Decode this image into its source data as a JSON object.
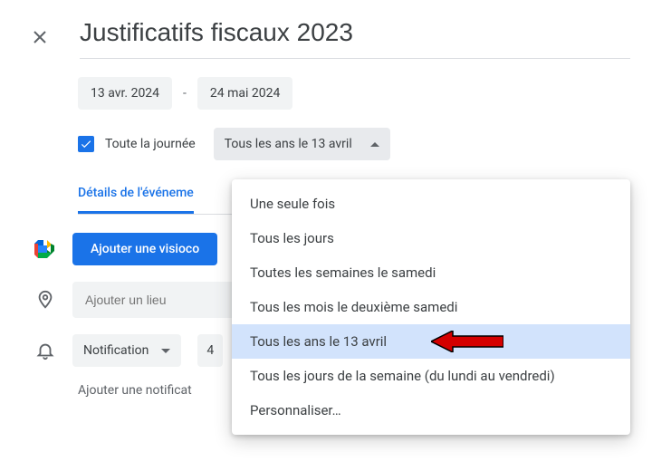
{
  "title": "Justificatifs fiscaux 2023",
  "dates": {
    "start": "13 avr. 2024",
    "sep": "-",
    "end": "24 mai 2024"
  },
  "all_day": {
    "checked": true,
    "label": "Toute la journée"
  },
  "recurrence": {
    "selected_label": "Tous les ans le 13 avril",
    "options": [
      "Une seule fois",
      "Tous les jours",
      "Toutes les semaines le samedi",
      "Tous les mois le deuxième samedi",
      "Tous les ans le 13 avril",
      "Tous les jours de la semaine (du lundi au vendredi)",
      "Personnaliser…"
    ],
    "selected_index": 4
  },
  "tabs": {
    "details": "Détails de l'événeme"
  },
  "meet_button": "Ajouter une visioco",
  "location_placeholder": "Ajouter un lieu",
  "notification": {
    "type_label": "Notification",
    "value": "4"
  },
  "add_notification_label": "Ajouter une notificat"
}
